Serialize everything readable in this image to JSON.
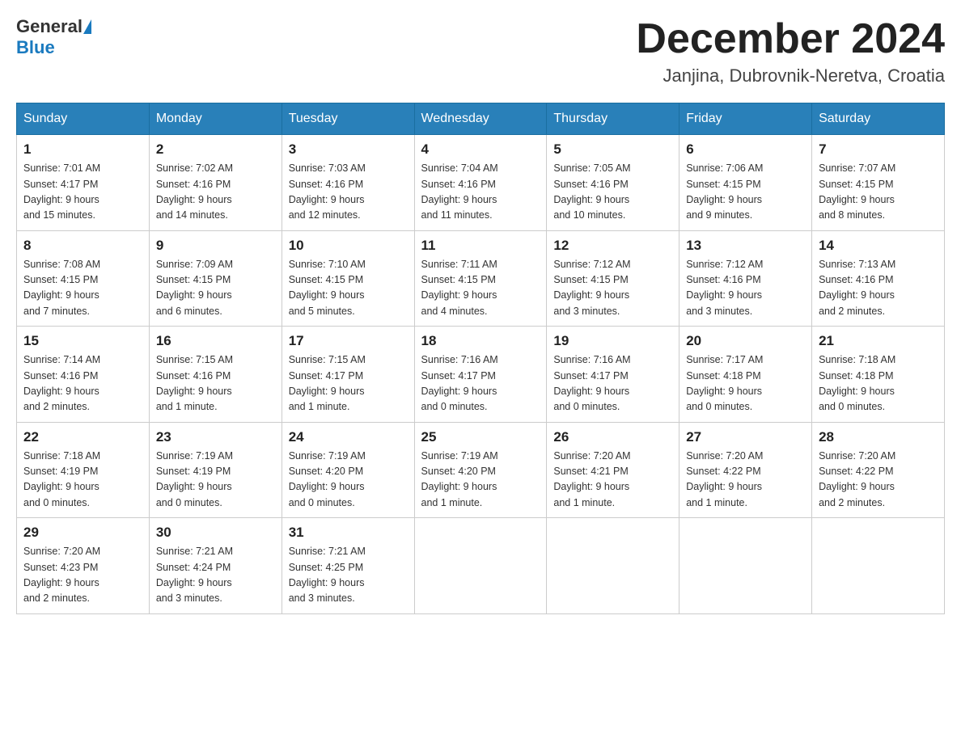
{
  "header": {
    "logo_general": "General",
    "logo_blue": "Blue",
    "month": "December 2024",
    "location": "Janjina, Dubrovnik-Neretva, Croatia"
  },
  "weekdays": [
    "Sunday",
    "Monday",
    "Tuesday",
    "Wednesday",
    "Thursday",
    "Friday",
    "Saturday"
  ],
  "weeks": [
    [
      {
        "day": "1",
        "sunrise": "7:01 AM",
        "sunset": "4:17 PM",
        "daylight": "9 hours and 15 minutes."
      },
      {
        "day": "2",
        "sunrise": "7:02 AM",
        "sunset": "4:16 PM",
        "daylight": "9 hours and 14 minutes."
      },
      {
        "day": "3",
        "sunrise": "7:03 AM",
        "sunset": "4:16 PM",
        "daylight": "9 hours and 12 minutes."
      },
      {
        "day": "4",
        "sunrise": "7:04 AM",
        "sunset": "4:16 PM",
        "daylight": "9 hours and 11 minutes."
      },
      {
        "day": "5",
        "sunrise": "7:05 AM",
        "sunset": "4:16 PM",
        "daylight": "9 hours and 10 minutes."
      },
      {
        "day": "6",
        "sunrise": "7:06 AM",
        "sunset": "4:15 PM",
        "daylight": "9 hours and 9 minutes."
      },
      {
        "day": "7",
        "sunrise": "7:07 AM",
        "sunset": "4:15 PM",
        "daylight": "9 hours and 8 minutes."
      }
    ],
    [
      {
        "day": "8",
        "sunrise": "7:08 AM",
        "sunset": "4:15 PM",
        "daylight": "9 hours and 7 minutes."
      },
      {
        "day": "9",
        "sunrise": "7:09 AM",
        "sunset": "4:15 PM",
        "daylight": "9 hours and 6 minutes."
      },
      {
        "day": "10",
        "sunrise": "7:10 AM",
        "sunset": "4:15 PM",
        "daylight": "9 hours and 5 minutes."
      },
      {
        "day": "11",
        "sunrise": "7:11 AM",
        "sunset": "4:15 PM",
        "daylight": "9 hours and 4 minutes."
      },
      {
        "day": "12",
        "sunrise": "7:12 AM",
        "sunset": "4:15 PM",
        "daylight": "9 hours and 3 minutes."
      },
      {
        "day": "13",
        "sunrise": "7:12 AM",
        "sunset": "4:16 PM",
        "daylight": "9 hours and 3 minutes."
      },
      {
        "day": "14",
        "sunrise": "7:13 AM",
        "sunset": "4:16 PM",
        "daylight": "9 hours and 2 minutes."
      }
    ],
    [
      {
        "day": "15",
        "sunrise": "7:14 AM",
        "sunset": "4:16 PM",
        "daylight": "9 hours and 2 minutes."
      },
      {
        "day": "16",
        "sunrise": "7:15 AM",
        "sunset": "4:16 PM",
        "daylight": "9 hours and 1 minute."
      },
      {
        "day": "17",
        "sunrise": "7:15 AM",
        "sunset": "4:17 PM",
        "daylight": "9 hours and 1 minute."
      },
      {
        "day": "18",
        "sunrise": "7:16 AM",
        "sunset": "4:17 PM",
        "daylight": "9 hours and 0 minutes."
      },
      {
        "day": "19",
        "sunrise": "7:16 AM",
        "sunset": "4:17 PM",
        "daylight": "9 hours and 0 minutes."
      },
      {
        "day": "20",
        "sunrise": "7:17 AM",
        "sunset": "4:18 PM",
        "daylight": "9 hours and 0 minutes."
      },
      {
        "day": "21",
        "sunrise": "7:18 AM",
        "sunset": "4:18 PM",
        "daylight": "9 hours and 0 minutes."
      }
    ],
    [
      {
        "day": "22",
        "sunrise": "7:18 AM",
        "sunset": "4:19 PM",
        "daylight": "9 hours and 0 minutes."
      },
      {
        "day": "23",
        "sunrise": "7:19 AM",
        "sunset": "4:19 PM",
        "daylight": "9 hours and 0 minutes."
      },
      {
        "day": "24",
        "sunrise": "7:19 AM",
        "sunset": "4:20 PM",
        "daylight": "9 hours and 0 minutes."
      },
      {
        "day": "25",
        "sunrise": "7:19 AM",
        "sunset": "4:20 PM",
        "daylight": "9 hours and 1 minute."
      },
      {
        "day": "26",
        "sunrise": "7:20 AM",
        "sunset": "4:21 PM",
        "daylight": "9 hours and 1 minute."
      },
      {
        "day": "27",
        "sunrise": "7:20 AM",
        "sunset": "4:22 PM",
        "daylight": "9 hours and 1 minute."
      },
      {
        "day": "28",
        "sunrise": "7:20 AM",
        "sunset": "4:22 PM",
        "daylight": "9 hours and 2 minutes."
      }
    ],
    [
      {
        "day": "29",
        "sunrise": "7:20 AM",
        "sunset": "4:23 PM",
        "daylight": "9 hours and 2 minutes."
      },
      {
        "day": "30",
        "sunrise": "7:21 AM",
        "sunset": "4:24 PM",
        "daylight": "9 hours and 3 minutes."
      },
      {
        "day": "31",
        "sunrise": "7:21 AM",
        "sunset": "4:25 PM",
        "daylight": "9 hours and 3 minutes."
      },
      null,
      null,
      null,
      null
    ]
  ],
  "labels": {
    "sunrise": "Sunrise:",
    "sunset": "Sunset:",
    "daylight": "Daylight:"
  }
}
